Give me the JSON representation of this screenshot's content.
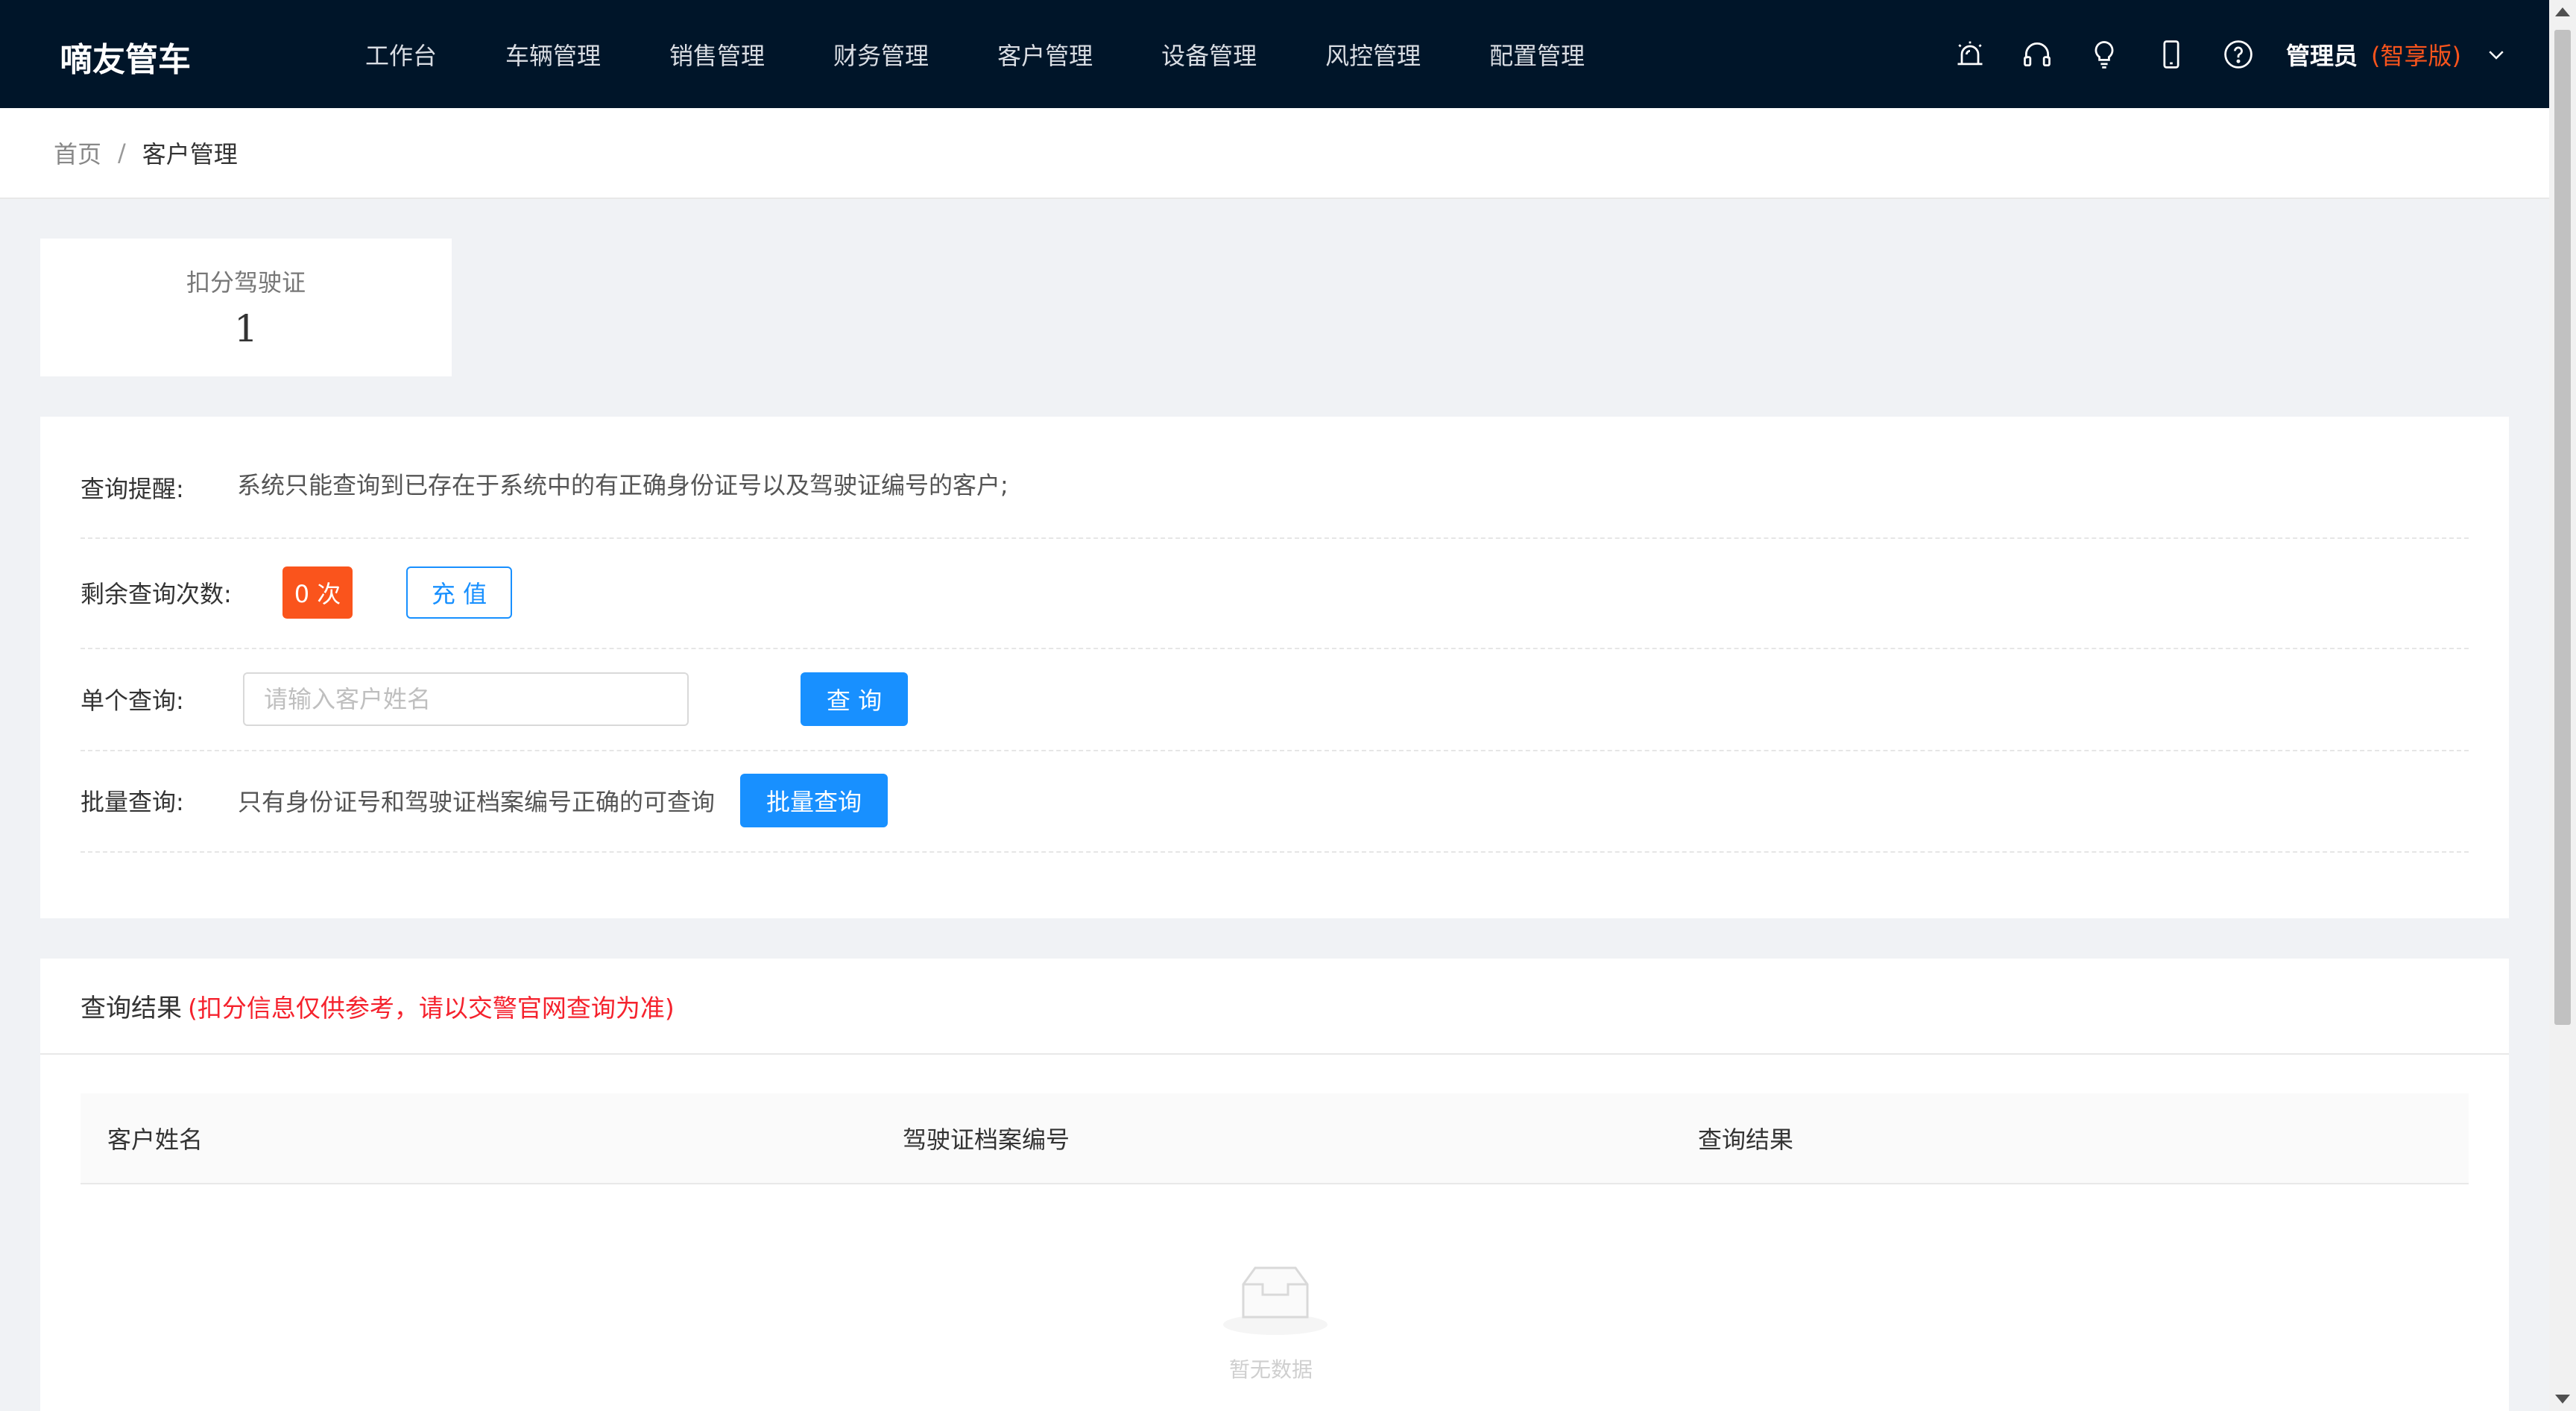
{
  "header": {
    "brand": "嘀友管车",
    "nav": [
      "工作台",
      "车辆管理",
      "销售管理",
      "财务管理",
      "客户管理",
      "设备管理",
      "风控管理",
      "配置管理"
    ],
    "user": "管理员",
    "edition": "(智享版)",
    "icons": [
      "alarm-icon",
      "headset-icon",
      "lightbulb-icon",
      "mobile-icon",
      "help-icon"
    ]
  },
  "breadcrumb": {
    "home": "首页",
    "separator": "/",
    "current": "客户管理"
  },
  "stat": {
    "label": "扣分驾驶证",
    "value": "1"
  },
  "query": {
    "notice_label": "查询提醒:",
    "notice_text": "系统只能查询到已存在于系统中的有正确身份证号以及驾驶证编号的客户;",
    "remaining_label": "剩余查询次数:",
    "remaining_count": "0 次",
    "recharge_label": "充 值",
    "single_label": "单个查询:",
    "single_placeholder": "请输入客户姓名",
    "single_button": "查 询",
    "batch_label": "批量查询:",
    "batch_text": "只有身份证号和驾驶证档案编号正确的可查询",
    "batch_button": "批量查询"
  },
  "results": {
    "title": "查询结果",
    "note": "(扣分信息仅供参考，请以交警官网查询为准)",
    "columns": [
      "客户姓名",
      "驾驶证档案编号",
      "查询结果"
    ],
    "rows": [],
    "empty_text": "暂无数据"
  },
  "colors": {
    "header_bg": "#001529",
    "primary": "#1890ff",
    "accent": "#fa541c",
    "warning_text": "#f5222d"
  }
}
